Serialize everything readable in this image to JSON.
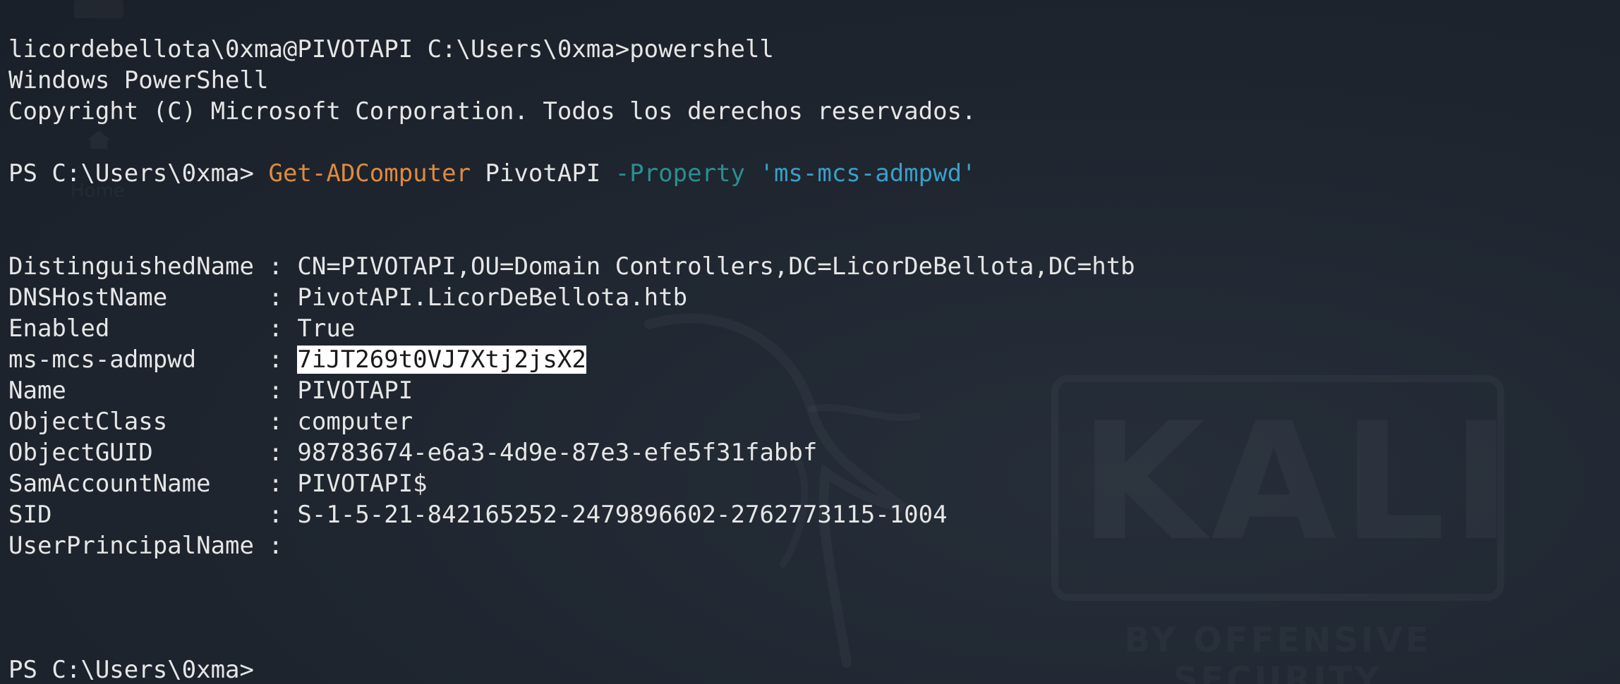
{
  "terminal": {
    "lines": [
      {
        "text": "licordebellota\\0xma@PIVOTAPI C:\\Users\\0xma>powershell"
      },
      {
        "text": "Windows PowerShell"
      },
      {
        "text": "Copyright (C) Microsoft Corporation. Todos los derechos reservados."
      },
      {
        "text": ""
      },
      {
        "prompt": "PS C:\\Users\\0xma> ",
        "cmdlet": "Get-ADComputer",
        "arg": " PivotAPI ",
        "param": "-Property",
        "space": " ",
        "string": "'ms-mcs-admpwd'"
      },
      {
        "text": ""
      },
      {
        "text": ""
      },
      {
        "key": "DistinguishedName : ",
        "value": "CN=PIVOTAPI,OU=Domain Controllers,DC=LicorDeBellota,DC=htb"
      },
      {
        "key": "DNSHostName       : ",
        "value": "PivotAPI.LicorDeBellota.htb"
      },
      {
        "key": "Enabled           : ",
        "value": "True"
      },
      {
        "key": "ms-mcs-admpwd     : ",
        "value": "7iJT269t0VJ7Xtj2jsX2",
        "selected": true
      },
      {
        "key": "Name              : ",
        "value": "PIVOTAPI"
      },
      {
        "key": "ObjectClass       : ",
        "value": "computer"
      },
      {
        "key": "ObjectGUID        : ",
        "value": "98783674-e6a3-4d9e-87e3-efe5f31fabbf"
      },
      {
        "key": "SamAccountName    : ",
        "value": "PIVOTAPI$"
      },
      {
        "key": "SID               : ",
        "value": "S-1-5-21-842165252-2479896602-2762773115-1004"
      },
      {
        "key": "UserPrincipalName : ",
        "value": ""
      },
      {
        "text": ""
      },
      {
        "text": ""
      },
      {
        "text": ""
      },
      {
        "text": "PS C:\\Users\\0xma>"
      }
    ]
  },
  "wallpaper": {
    "brand": "KALI",
    "tagline": "BY OFFENSIVE SECURITY",
    "desktop_label": "Home"
  },
  "colors": {
    "background": "#1f2630",
    "text": "#e6e6e6",
    "cmdlet": "#e08a3c",
    "parameter": "#2a8f8f",
    "string": "#3aa0c8",
    "selection_bg": "#ffffff",
    "selection_fg": "#1a1a1a"
  }
}
